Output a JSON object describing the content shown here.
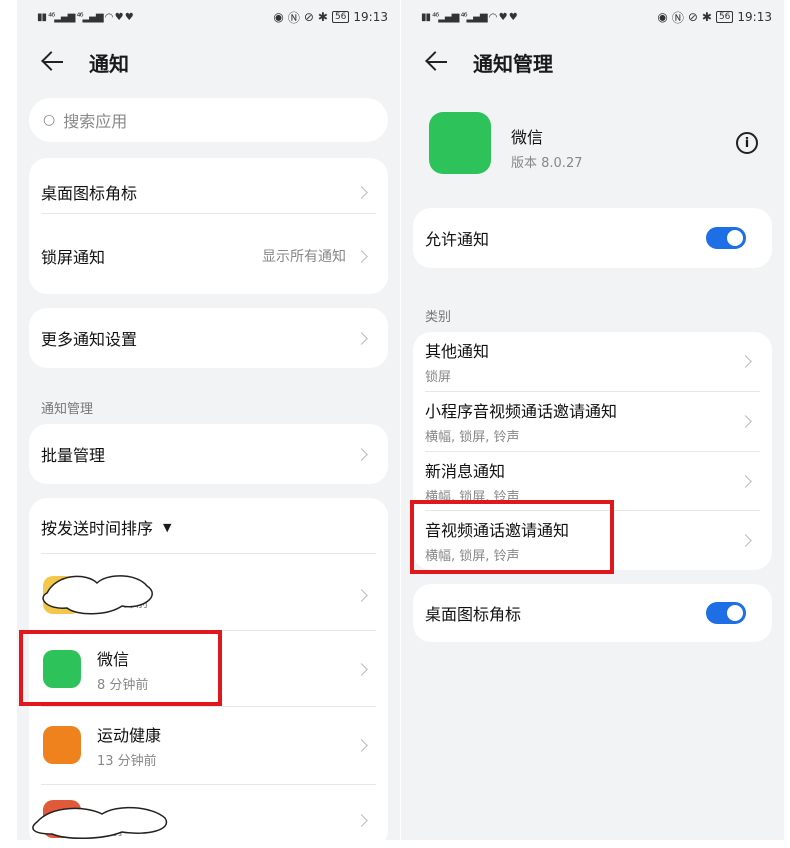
{
  "status": {
    "time": "19:13",
    "battery": "56"
  },
  "left": {
    "title": "通知",
    "search_placeholder": "搜索应用",
    "desktop_badge": "桌面图标角标",
    "lockscreen": "锁屏通知",
    "lockscreen_value": "显示所有通知",
    "more_settings": "更多通知设置",
    "section_manage": "通知管理",
    "batch_manage": "批量管理",
    "sort_label": "按发送时间排序",
    "sort_arrow": "▼",
    "apps": [
      {
        "name": "",
        "time": "2 分钟前"
      },
      {
        "name": "微信",
        "time": "8 分钟前"
      },
      {
        "name": "运动健康",
        "time": "13 分钟前"
      },
      {
        "name": "",
        "time": "钟前"
      }
    ]
  },
  "right": {
    "title": "通知管理",
    "app_name": "微信",
    "app_version": "版本 8.0.27",
    "info_glyph": "i",
    "allow_notifications": "允许通知",
    "allow_on": true,
    "section_category": "类别",
    "categories": [
      {
        "title": "其他通知",
        "sub": "锁屏"
      },
      {
        "title": "小程序音视频通话邀请通知",
        "sub": "横幅, 锁屏, 铃声"
      },
      {
        "title": "新消息通知",
        "sub": "横幅, 锁屏, 铃声"
      },
      {
        "title": "音视频通话邀请通知",
        "sub": "横幅, 锁屏, 铃声"
      }
    ],
    "desktop_badge": "桌面图标角标",
    "desktop_badge_on": true
  },
  "colors": {
    "accent": "#1e6ee6",
    "highlight": "#e0171d",
    "wechat": "#2dc25a",
    "health": "#f0821e"
  }
}
